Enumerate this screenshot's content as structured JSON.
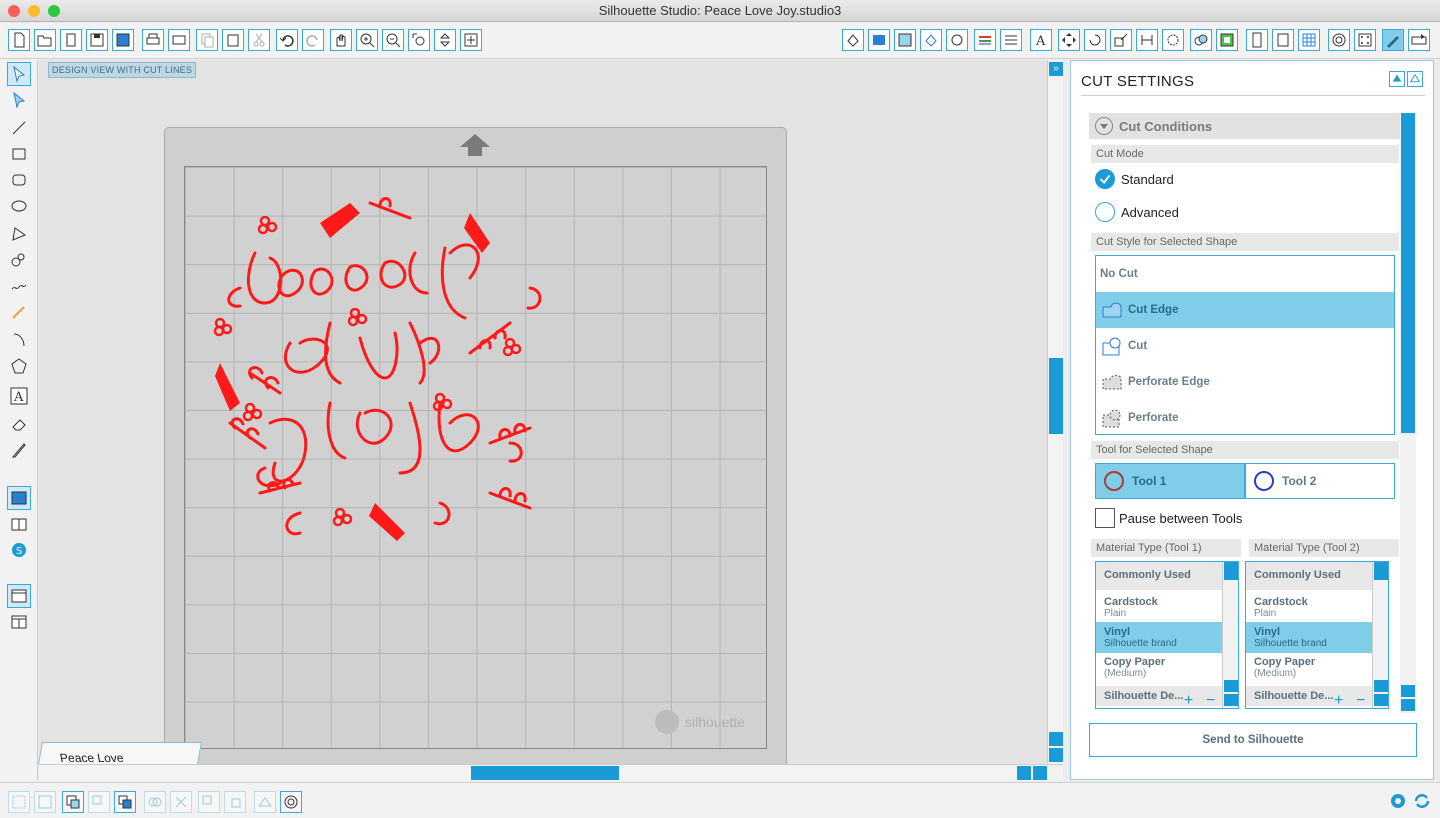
{
  "window": {
    "title": "Silhouette Studio: Peace Love Joy.studio3"
  },
  "workspace": {
    "view_label": "DESIGN VIEW WITH CUT LINES",
    "brand": "silhouette"
  },
  "document_tab": {
    "label": "Peace Love Joy.stu...",
    "close": "x"
  },
  "cut_settings": {
    "title": "CUT SETTINGS",
    "cut_conditions": "Cut Conditions",
    "cut_mode_label": "Cut Mode",
    "modes": [
      {
        "label": "Standard",
        "selected": true
      },
      {
        "label": "Advanced",
        "selected": false
      }
    ],
    "cut_style_label": "Cut Style for Selected Shape",
    "styles": [
      {
        "label": "No Cut",
        "icon": "none"
      },
      {
        "label": "Cut Edge",
        "icon": "cut-edge-icon",
        "selected": true
      },
      {
        "label": "Cut",
        "icon": "cut-icon"
      },
      {
        "label": "Perforate Edge",
        "icon": "perforate-edge-icon"
      },
      {
        "label": "Perforate",
        "icon": "perforate-icon"
      }
    ],
    "tool_label": "Tool for Selected Shape",
    "tools": [
      {
        "label": "Tool 1",
        "color": "#b03a3a",
        "selected": true
      },
      {
        "label": "Tool 2",
        "color": "#2b3ec9"
      }
    ],
    "pause_label": "Pause between Tools",
    "material_tool1_label": "Material Type (Tool 1)",
    "material_tool2_label": "Material Type (Tool 2)",
    "materials": [
      {
        "name": "Commonly Used",
        "sub": ""
      },
      {
        "name": "Cardstock",
        "sub": "Plain"
      },
      {
        "name": "Vinyl",
        "sub": "Silhouette brand",
        "selected": true
      },
      {
        "name": "Copy Paper",
        "sub": "(Medium)"
      },
      {
        "name": "Silhouette De...",
        "sub": ""
      }
    ],
    "send_button": "Send to Silhouette"
  },
  "colors": {
    "accent": "#3aa8d8",
    "design_red": "#ff1a1a"
  }
}
